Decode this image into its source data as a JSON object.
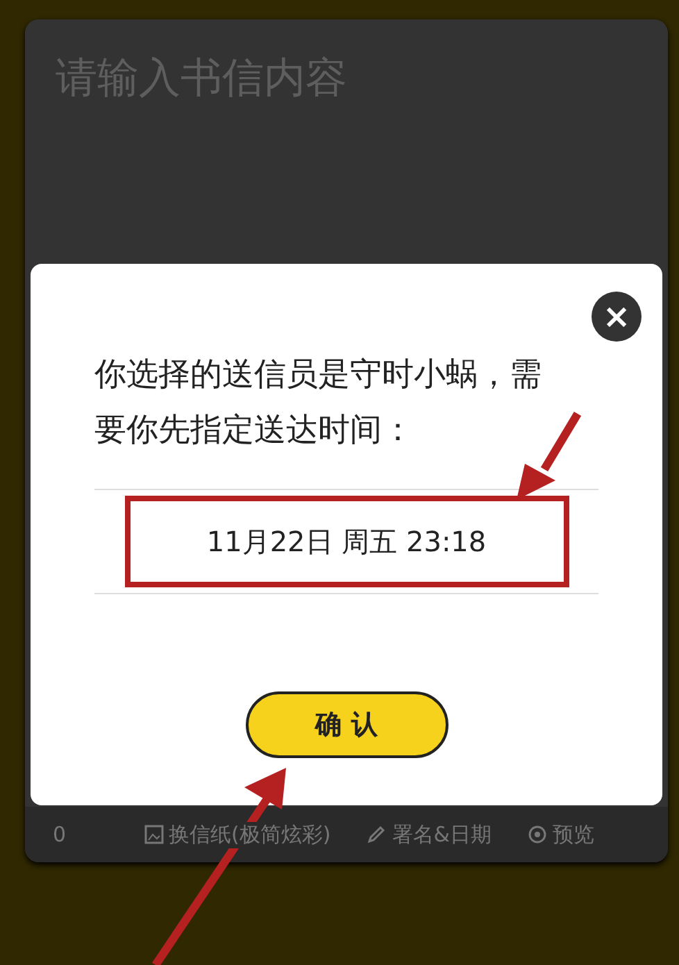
{
  "editor": {
    "placeholder": "请输入书信内容"
  },
  "toolbar": {
    "count": "0",
    "items": [
      "换信纸(极简炫彩)",
      "署名&日期",
      "预览"
    ]
  },
  "dialog": {
    "message": "你选择的送信员是守时小蜗，需要你先指定送达时间：",
    "time": "11月22日 周五 23:18",
    "close": "×",
    "confirm": "确 认"
  }
}
